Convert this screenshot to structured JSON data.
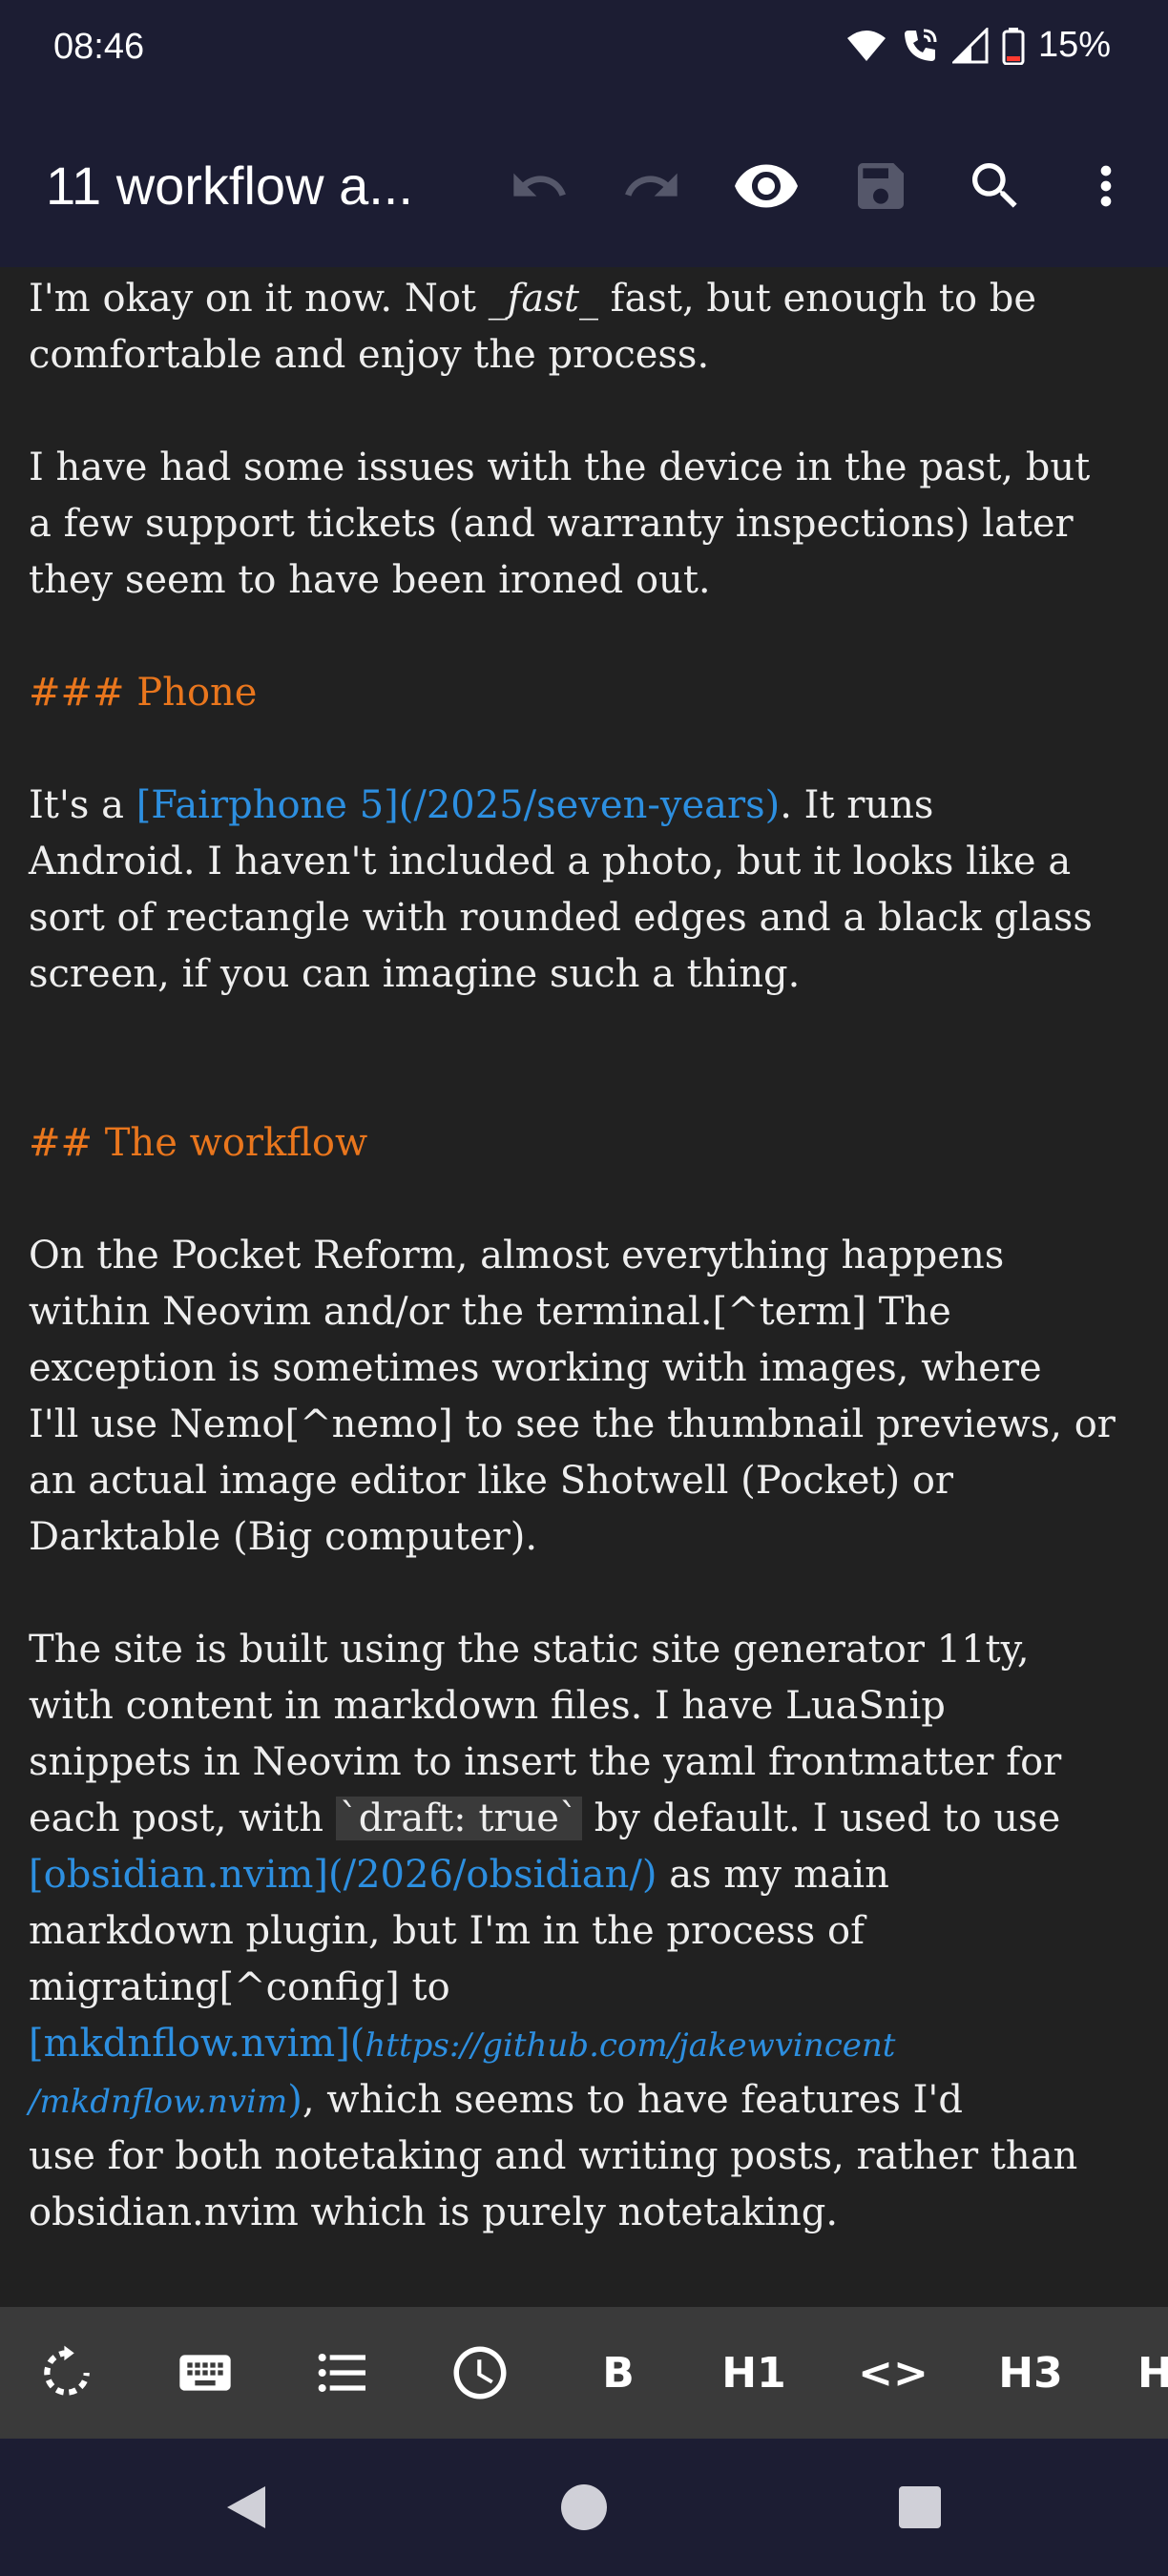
{
  "status_bar": {
    "time": "08:46",
    "battery_percent": "15%",
    "icons": [
      "wifi-icon",
      "wifi-calling-icon",
      "cell-signal-icon",
      "battery-low-icon"
    ]
  },
  "app_bar": {
    "title": "11 workflow a...",
    "actions": [
      "undo-icon",
      "redo-icon",
      "preview-eye-icon",
      "save-icon",
      "search-icon",
      "more-vert-icon"
    ]
  },
  "editor": {
    "lines": [
      [
        {
          "t": "I'm okay on it now. Not "
        },
        {
          "t": "_fast_",
          "s": "em"
        },
        {
          "t": " fast, but enough to be"
        }
      ],
      [
        {
          "t": "comfortable and enjoy the process."
        }
      ],
      [],
      [
        {
          "t": "I have had some issues with the device in the past, but"
        }
      ],
      [
        {
          "t": "a few support tickets (and warranty inspections) later"
        }
      ],
      [
        {
          "t": "they seem to have been ironed out."
        }
      ],
      [],
      [
        {
          "t": "### Phone",
          "s": "heading"
        }
      ],
      [],
      [
        {
          "t": "It's a "
        },
        {
          "t": "[Fairphone 5](/2025/seven-years)",
          "s": "link"
        },
        {
          "t": ". It runs"
        }
      ],
      [
        {
          "t": "Android. I haven't included a photo, but it looks like a"
        }
      ],
      [
        {
          "t": "sort of rectangle with rounded edges and a black glass"
        }
      ],
      [
        {
          "t": "screen, if you can imagine such a thing."
        }
      ],
      [],
      [],
      [
        {
          "t": "## The workflow",
          "s": "heading"
        }
      ],
      [],
      [
        {
          "t": "On the Pocket Reform, almost everything happens"
        }
      ],
      [
        {
          "t": "within Neovim and/or the terminal.[^term] The"
        }
      ],
      [
        {
          "t": "exception is sometimes working with images, where"
        }
      ],
      [
        {
          "t": "I'll use Nemo[^nemo] to see the thumbnail previews, or"
        }
      ],
      [
        {
          "t": "an actual image editor like Shotwell (Pocket) or"
        }
      ],
      [
        {
          "t": "Darktable (Big computer)."
        }
      ],
      [],
      [
        {
          "t": "The site is built using the static site generator 11ty,"
        }
      ],
      [
        {
          "t": "with content in markdown files. I have LuaSnip"
        }
      ],
      [
        {
          "t": "snippets in Neovim to insert the yaml frontmatter for"
        }
      ],
      [
        {
          "t": "each post, with "
        },
        {
          "t": "`draft: true`",
          "s": "code"
        },
        {
          "t": " by default. I used to use"
        }
      ],
      [
        {
          "t": "[obsidian.nvim](/2026/obsidian/)",
          "s": "link"
        },
        {
          "t": " as my main"
        }
      ],
      [
        {
          "t": "markdown plugin, but I'm in the process of"
        }
      ],
      [
        {
          "t": "migrating[^config] to"
        }
      ],
      [
        {
          "t": "[mkdnflow.nvim](",
          "s": "link"
        },
        {
          "t": "https://github.com/jakewvincent",
          "s": "link url-italic"
        }
      ],
      [
        {
          "t": "/mkdnflow.nvim",
          "s": "link url-italic"
        },
        {
          "t": ")",
          "s": "link"
        },
        {
          "t": ", which seems to have features I'd"
        }
      ],
      [
        {
          "t": "use for both notetaking and writing posts, rather than"
        }
      ],
      [
        {
          "t": "obsidian.nvim which is purely notetaking."
        }
      ]
    ]
  },
  "format_bar": {
    "items": [
      {
        "icon": "rotate-icon",
        "label": ""
      },
      {
        "icon": "keyboard-icon",
        "label": ""
      },
      {
        "icon": "list-icon",
        "label": ""
      },
      {
        "icon": "clock-icon",
        "label": ""
      },
      {
        "icon": "bold-icon",
        "label": "B"
      },
      {
        "icon": "h1-icon",
        "label": "H1"
      },
      {
        "icon": "code-icon",
        "label": "<>"
      },
      {
        "icon": "h3-icon",
        "label": "H3"
      },
      {
        "icon": "h-partial-icon",
        "label": "H"
      }
    ]
  },
  "nav_bar": {
    "buttons": [
      "back-icon",
      "home-icon",
      "recents-icon"
    ]
  },
  "colors": {
    "bar_background": "#1c1d33",
    "editor_background": "#212121",
    "heading": "#e9761d",
    "link": "#2d8fe0",
    "format_bar": "#3a3a3a"
  }
}
